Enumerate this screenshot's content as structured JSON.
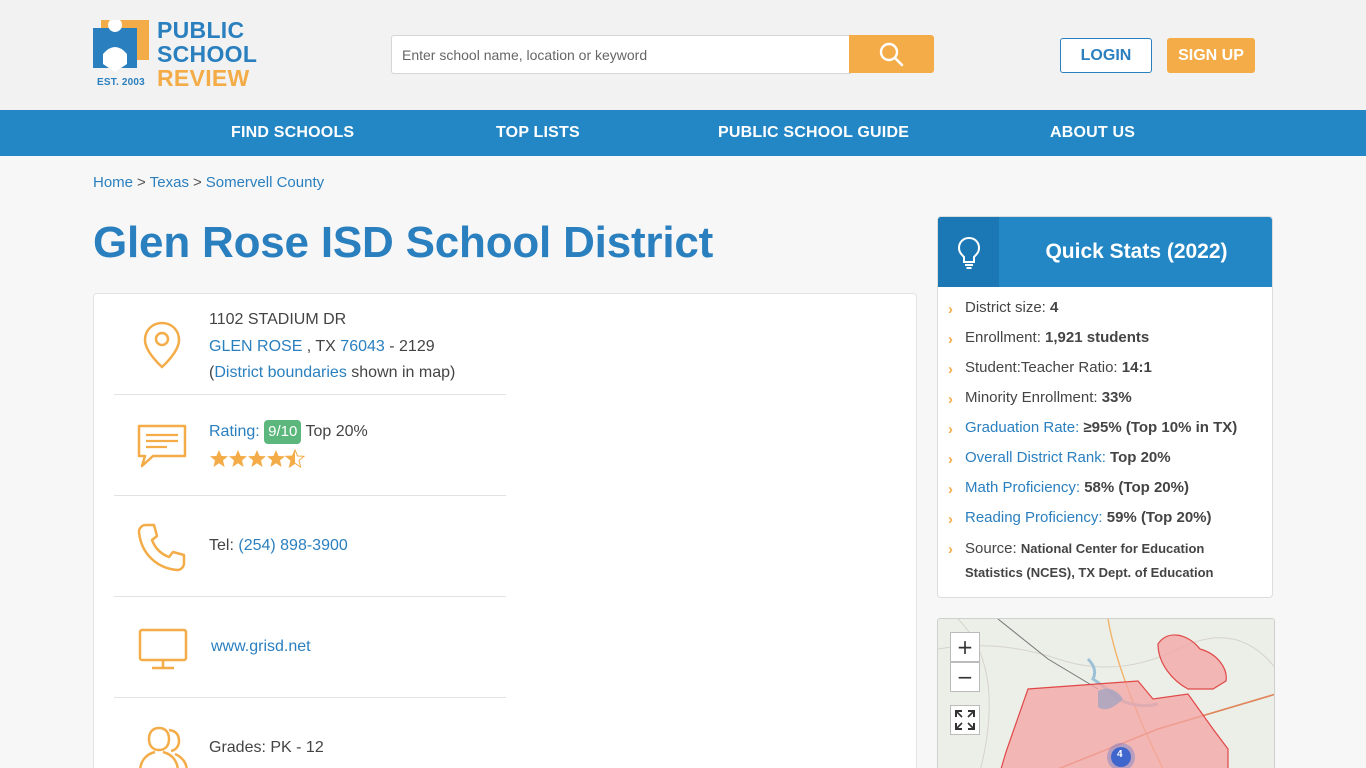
{
  "header": {
    "logo": {
      "line1": "PUBLIC",
      "line2": "SCHOOL",
      "line3": "REVIEW",
      "est": "EST. 2003"
    },
    "search": {
      "placeholder": "Enter school name, location or keyword",
      "icon": "search-icon"
    },
    "login_label": "LOGIN",
    "signup_label": "SIGN UP"
  },
  "nav": {
    "items": [
      {
        "label": "FIND SCHOOLS"
      },
      {
        "label": "TOP LISTS"
      },
      {
        "label": "PUBLIC SCHOOL GUIDE"
      },
      {
        "label": "ABOUT US"
      }
    ]
  },
  "breadcrumb": {
    "items": [
      "Home",
      "Texas",
      "Somervell County"
    ],
    "separator": ">"
  },
  "page": {
    "title": "Glen Rose ISD School District"
  },
  "info": {
    "address": {
      "street": "1102 STADIUM DR",
      "city": "GLEN ROSE",
      "state_sep": " , TX ",
      "zip": "76043",
      "zip4": " - 2129",
      "open_paren": "(",
      "boundaries_link": "District boundaries",
      "boundaries_tail": " shown in map)"
    },
    "rating": {
      "label": "Rating:",
      "badge": "9/10",
      "rank": "Top 20%",
      "stars": 4.5
    },
    "phone": {
      "label": "Tel:",
      "number": "(254) 898-3900"
    },
    "website": {
      "url": "www.grisd.net"
    },
    "grades": {
      "text": "Grades: PK - 12"
    }
  },
  "quick_stats": {
    "title": "Quick Stats (2022)",
    "items": [
      {
        "label": "District size:",
        "value": "4"
      },
      {
        "label": "Enrollment:",
        "value": "1,921 students"
      },
      {
        "label": "Student:Teacher Ratio:",
        "value": "14:1"
      },
      {
        "label": "Minority Enrollment:",
        "value": "33%"
      },
      {
        "label": "Graduation Rate:",
        "value": "≥95% (Top 10% in TX)"
      },
      {
        "label": "Overall District Rank:",
        "value": "Top 20%"
      },
      {
        "label": "Math Proficiency:",
        "value": "58% (Top 20%)"
      },
      {
        "label": "Reading Proficiency:",
        "value": "59% (Top 20%)"
      }
    ],
    "source_label": "Source:",
    "source_line1": "National Center for Education",
    "source_line2": "Statistics (NCES), TX Dept. of Education"
  },
  "map": {
    "zoom_in": "+",
    "zoom_out": "−",
    "cluster_count": "4"
  },
  "colors": {
    "brand_blue": "#2387c6",
    "brand_orange": "#f3ac47",
    "rating_green": "#5cb77c"
  }
}
